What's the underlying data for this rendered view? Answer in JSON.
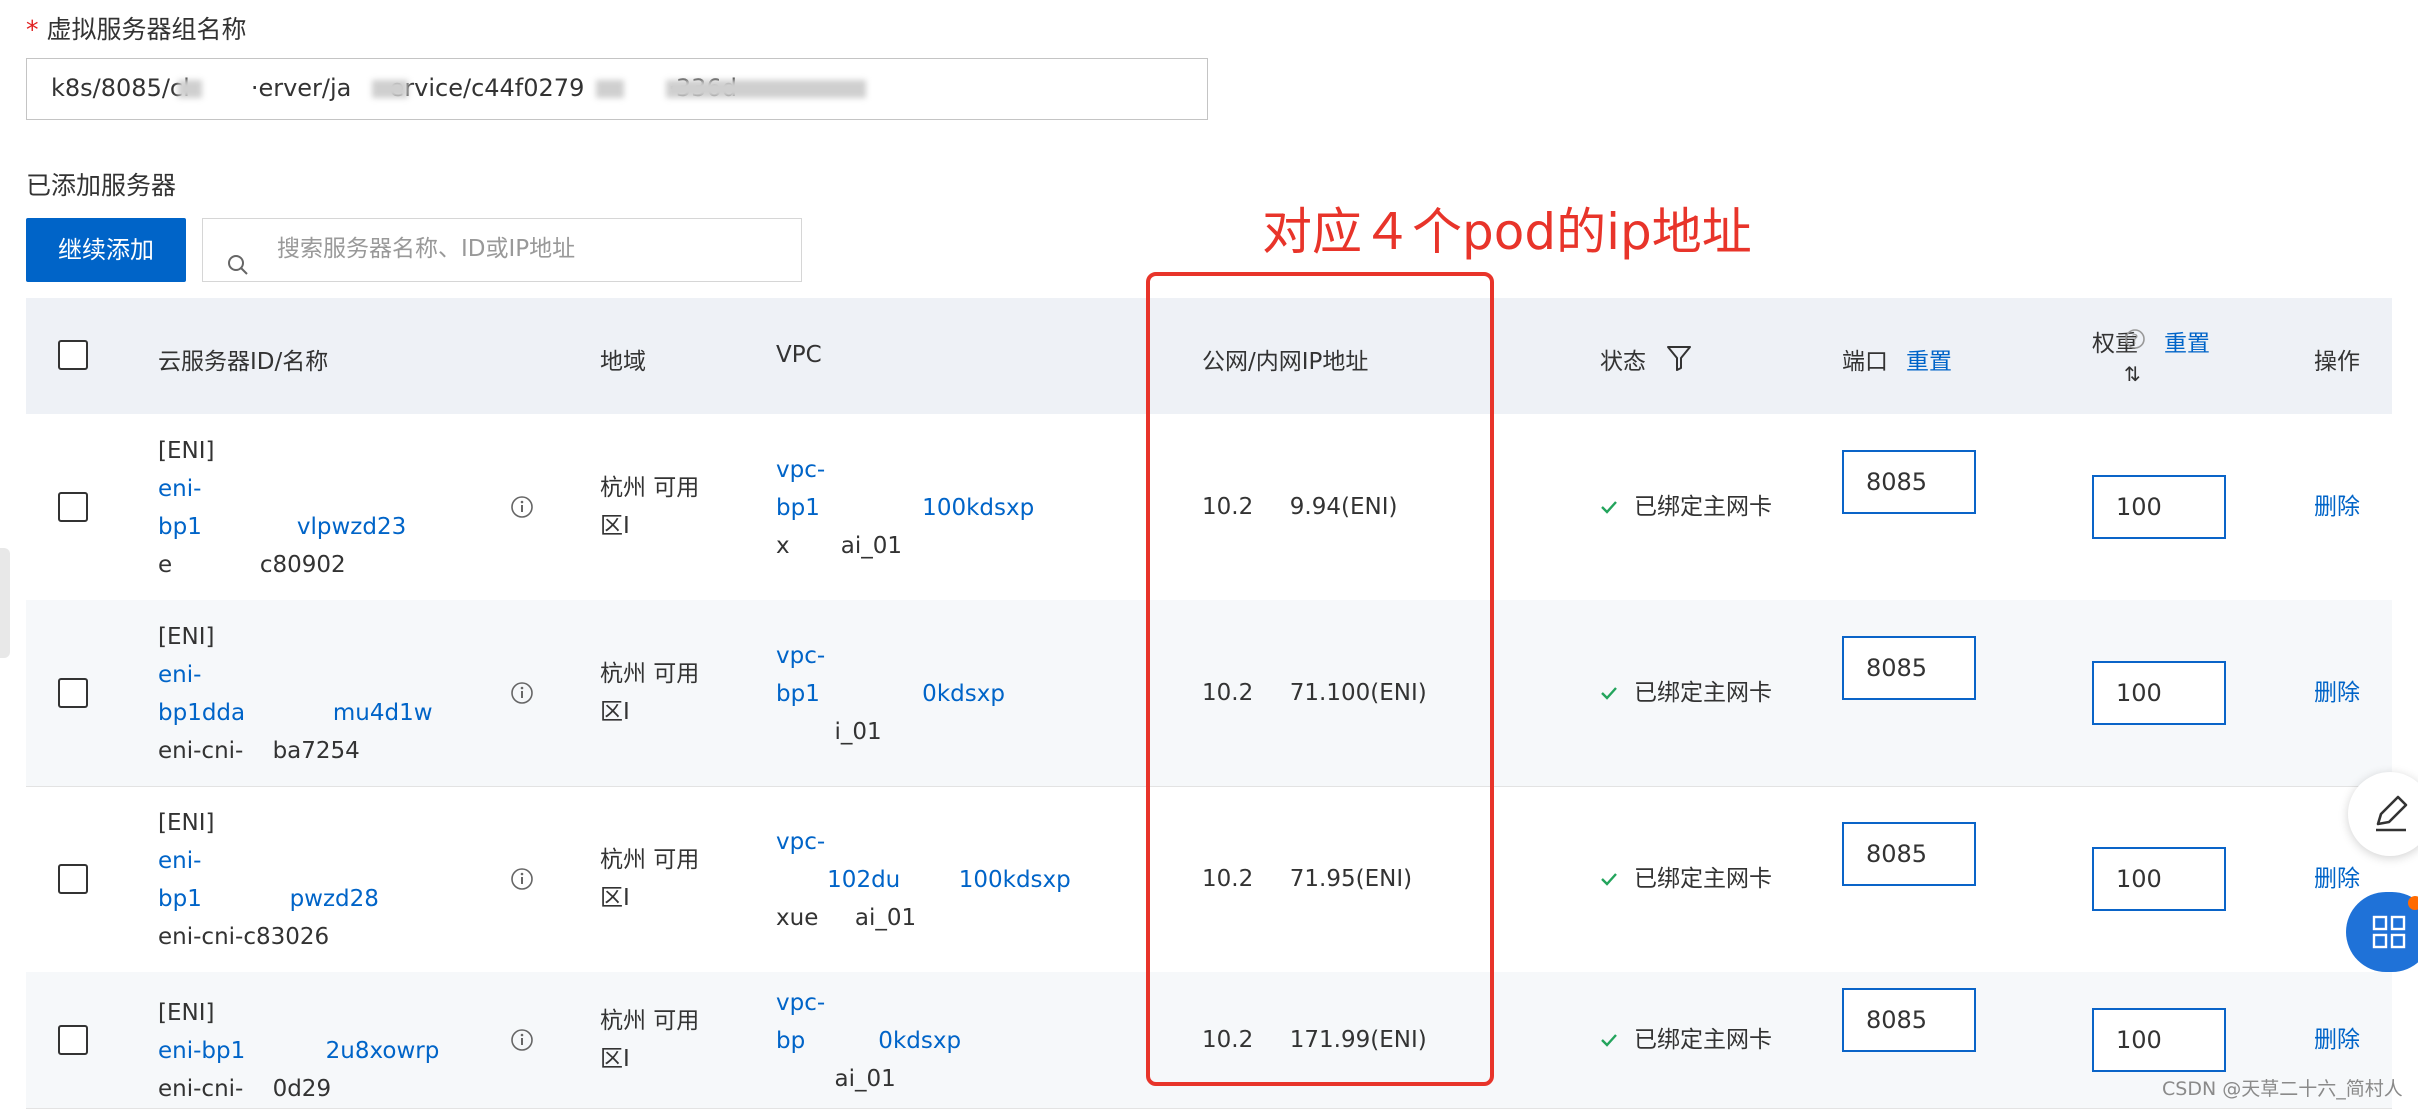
{
  "form": {
    "required_mark": "*",
    "name_label": "虚拟服务器组名称",
    "name_value": "k8s/8085/cl        ·erver/ja     ervice/c44f0279           ·336d"
  },
  "added": {
    "label": "已添加服务器",
    "add_button": "继续添加",
    "search_placeholder": "搜索服务器名称、ID或IP地址"
  },
  "annotation": {
    "text": "对应４个pod的ip地址",
    "color": "#e8342a"
  },
  "table": {
    "headers": {
      "id_name": "云服务器ID/名称",
      "region": "地域",
      "vpc": "VPC",
      "ip": "公网/内网IP地址",
      "status": "状态",
      "port": "端口",
      "port_reset": "重置",
      "weight": "权重",
      "weight_sort": "⇅",
      "weight_reset": "重置",
      "action": "操作"
    },
    "rows": [
      {
        "tag": "[ENI]",
        "id_line1": "eni-",
        "id_line2": "bp1             vlpwzd23",
        "name": "e            c80902",
        "region_line1": "杭州 可用",
        "region_line2": "区I",
        "vpc_line1": "vpc-",
        "vpc_line2": "bp1              100kdsxp",
        "vpc_name": "x       ai_01",
        "ip": "10.2     9.94(ENI)",
        "status": "已绑定主网卡",
        "port": "8085",
        "weight": "100",
        "action": "删除"
      },
      {
        "tag": "[ENI]",
        "id_line1": "eni-",
        "id_line2": "bp1dda            mu4d1w",
        "name": "eni-cni-    ba7254",
        "region_line1": "杭州 可用",
        "region_line2": "区I",
        "vpc_line1": "vpc-",
        "vpc_line2": "bp1              0kdsxp",
        "vpc_name": "        i_01",
        "ip": "10.2     71.100(ENI)",
        "status": "已绑定主网卡",
        "port": "8085",
        "weight": "100",
        "action": "删除"
      },
      {
        "tag": "[ENI]",
        "id_line1": "eni-",
        "id_line2": "bp1            pwzd28",
        "name": "eni-cni-c83026",
        "region_line1": "杭州 可用",
        "region_line2": "区I",
        "vpc_line1": "vpc-",
        "vpc_line2": "       102du        100kdsxp",
        "vpc_name": "xue     ai_01",
        "ip": "10.2     71.95(ENI)",
        "status": "已绑定主网卡",
        "port": "8085",
        "weight": "100",
        "action": "删除"
      },
      {
        "tag": "[ENI]",
        "id_line1": "eni-bp1           2u8xowrp",
        "id_line2": "",
        "name": "eni-cni-    0d29",
        "region_line1": "杭州 可用",
        "region_line2": "区I",
        "vpc_line1": "vpc-",
        "vpc_line2": "bp          0kdsxp",
        "vpc_name": "        ai_01",
        "ip": "10.2     171.99(ENI)",
        "status": "已绑定主网卡",
        "port": "8085",
        "weight": "100",
        "action": "删除"
      }
    ]
  },
  "watermark": "CSDN @天草二十六_简村人",
  "colors": {
    "accent": "#0064c8",
    "annotation": "#e8342a",
    "success": "#23a45c"
  }
}
